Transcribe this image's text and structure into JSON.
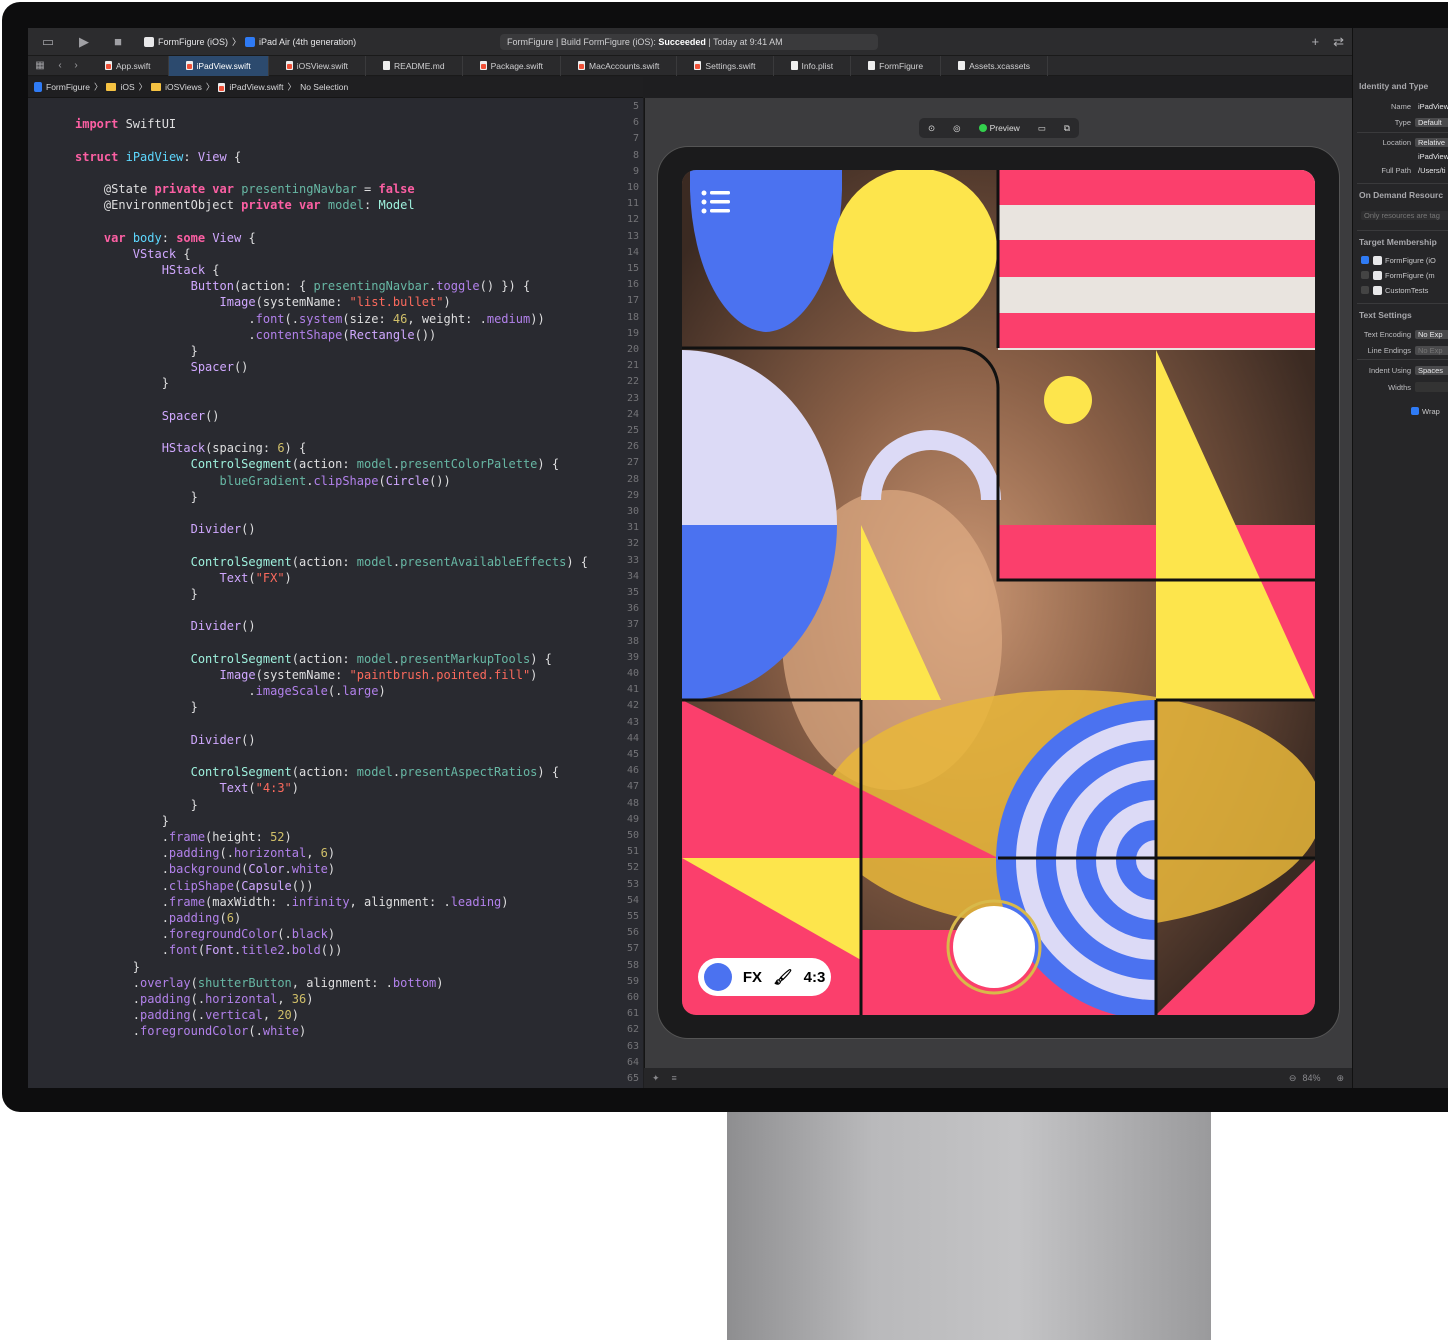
{
  "toolbar": {
    "scheme": "FormFigure (iOS)",
    "device": "iPad Air (4th generation)",
    "status_prefix": "FormFigure | Build FormFigure (iOS): ",
    "status_result": "Succeeded",
    "status_time": " | Today at 9:41 AM"
  },
  "tabs": [
    {
      "label": "App.swift"
    },
    {
      "label": "iPadView.swift",
      "active": true
    },
    {
      "label": "iOSView.swift"
    },
    {
      "label": "README.md"
    },
    {
      "label": "Package.swift"
    },
    {
      "label": "MacAccounts.swift"
    },
    {
      "label": "Settings.swift"
    },
    {
      "label": "Info.plist"
    },
    {
      "label": "FormFigure"
    },
    {
      "label": "Assets.xcassets"
    }
  ],
  "breadcrumb": [
    "FormFigure",
    "iOS",
    "iOSViews",
    "iPadView.swift",
    "No Selection"
  ],
  "code": {
    "first_line": 5,
    "lines": [
      [],
      [
        [
          "k",
          "import"
        ],
        [
          "p",
          " SwiftUI"
        ]
      ],
      [],
      [
        [
          "k",
          "struct"
        ],
        [
          "p",
          " "
        ],
        [
          "d",
          "iPadView"
        ],
        [
          "p",
          ": "
        ],
        [
          "st",
          "View"
        ],
        [
          "p",
          " {"
        ]
      ],
      [],
      [
        [
          "p",
          "    @State "
        ],
        [
          "k",
          "private var"
        ],
        [
          "p",
          " "
        ],
        [
          "m",
          "presentingNavbar"
        ],
        [
          "p",
          " = "
        ],
        [
          "k",
          "false"
        ]
      ],
      [
        [
          "p",
          "    @EnvironmentObject "
        ],
        [
          "k",
          "private var"
        ],
        [
          "p",
          " "
        ],
        [
          "m",
          "model"
        ],
        [
          "p",
          ": "
        ],
        [
          "t",
          "Model"
        ]
      ],
      [],
      [
        [
          "p",
          "    "
        ],
        [
          "k",
          "var"
        ],
        [
          "p",
          " "
        ],
        [
          "d",
          "body"
        ],
        [
          "p",
          ": "
        ],
        [
          "k",
          "some"
        ],
        [
          "p",
          " "
        ],
        [
          "st",
          "View"
        ],
        [
          "p",
          " {"
        ]
      ],
      [
        [
          "p",
          "        "
        ],
        [
          "st",
          "VStack"
        ],
        [
          "p",
          " {"
        ]
      ],
      [
        [
          "p",
          "            "
        ],
        [
          "st",
          "HStack"
        ],
        [
          "p",
          " {"
        ]
      ],
      [
        [
          "p",
          "                "
        ],
        [
          "st",
          "Button"
        ],
        [
          "p",
          "(action: { "
        ],
        [
          "m",
          "presentingNavbar"
        ],
        [
          "p",
          "."
        ],
        [
          "sm",
          "toggle"
        ],
        [
          "p",
          "() }) {"
        ]
      ],
      [
        [
          "p",
          "                    "
        ],
        [
          "st",
          "Image"
        ],
        [
          "p",
          "(systemName: "
        ],
        [
          "s",
          "\"list.bullet\""
        ],
        [
          "p",
          ")"
        ]
      ],
      [
        [
          "p",
          "                        ."
        ],
        [
          "sm",
          "font"
        ],
        [
          "p",
          "(."
        ],
        [
          "sm",
          "system"
        ],
        [
          "p",
          "(size: "
        ],
        [
          "n",
          "46"
        ],
        [
          "p",
          ", weight: ."
        ],
        [
          "sm",
          "medium"
        ],
        [
          "p",
          "))"
        ]
      ],
      [
        [
          "p",
          "                        ."
        ],
        [
          "sm",
          "contentShape"
        ],
        [
          "p",
          "("
        ],
        [
          "st",
          "Rectangle"
        ],
        [
          "p",
          "())"
        ]
      ],
      [
        [
          "p",
          "                }"
        ]
      ],
      [
        [
          "p",
          "                "
        ],
        [
          "st",
          "Spacer"
        ],
        [
          "p",
          "()"
        ]
      ],
      [
        [
          "p",
          "            }"
        ]
      ],
      [],
      [
        [
          "p",
          "            "
        ],
        [
          "st",
          "Spacer"
        ],
        [
          "p",
          "()"
        ]
      ],
      [],
      [
        [
          "p",
          "            "
        ],
        [
          "st",
          "HStack"
        ],
        [
          "p",
          "(spacing: "
        ],
        [
          "n",
          "6"
        ],
        [
          "p",
          ") {"
        ]
      ],
      [
        [
          "p",
          "                "
        ],
        [
          "t",
          "ControlSegment"
        ],
        [
          "p",
          "(action: "
        ],
        [
          "m",
          "model"
        ],
        [
          "p",
          "."
        ],
        [
          "m",
          "presentColorPalette"
        ],
        [
          "p",
          ") {"
        ]
      ],
      [
        [
          "p",
          "                    "
        ],
        [
          "m",
          "blueGradient"
        ],
        [
          "p",
          "."
        ],
        [
          "sm",
          "clipShape"
        ],
        [
          "p",
          "("
        ],
        [
          "st",
          "Circle"
        ],
        [
          "p",
          "())"
        ]
      ],
      [
        [
          "p",
          "                }"
        ]
      ],
      [],
      [
        [
          "p",
          "                "
        ],
        [
          "st",
          "Divider"
        ],
        [
          "p",
          "()"
        ]
      ],
      [],
      [
        [
          "p",
          "                "
        ],
        [
          "t",
          "ControlSegment"
        ],
        [
          "p",
          "(action: "
        ],
        [
          "m",
          "model"
        ],
        [
          "p",
          "."
        ],
        [
          "m",
          "presentAvailableEffects"
        ],
        [
          "p",
          ") {"
        ]
      ],
      [
        [
          "p",
          "                    "
        ],
        [
          "st",
          "Text"
        ],
        [
          "p",
          "("
        ],
        [
          "s",
          "\"FX\""
        ],
        [
          "p",
          ")"
        ]
      ],
      [
        [
          "p",
          "                }"
        ]
      ],
      [],
      [
        [
          "p",
          "                "
        ],
        [
          "st",
          "Divider"
        ],
        [
          "p",
          "()"
        ]
      ],
      [],
      [
        [
          "p",
          "                "
        ],
        [
          "t",
          "ControlSegment"
        ],
        [
          "p",
          "(action: "
        ],
        [
          "m",
          "model"
        ],
        [
          "p",
          "."
        ],
        [
          "m",
          "presentMarkupTools"
        ],
        [
          "p",
          ") {"
        ]
      ],
      [
        [
          "p",
          "                    "
        ],
        [
          "st",
          "Image"
        ],
        [
          "p",
          "(systemName: "
        ],
        [
          "s",
          "\"paintbrush.pointed.fill\""
        ],
        [
          "p",
          ")"
        ]
      ],
      [
        [
          "p",
          "                        ."
        ],
        [
          "sm",
          "imageScale"
        ],
        [
          "p",
          "(."
        ],
        [
          "sm",
          "large"
        ],
        [
          "p",
          ")"
        ]
      ],
      [
        [
          "p",
          "                }"
        ]
      ],
      [],
      [
        [
          "p",
          "                "
        ],
        [
          "st",
          "Divider"
        ],
        [
          "p",
          "()"
        ]
      ],
      [],
      [
        [
          "p",
          "                "
        ],
        [
          "t",
          "ControlSegment"
        ],
        [
          "p",
          "(action: "
        ],
        [
          "m",
          "model"
        ],
        [
          "p",
          "."
        ],
        [
          "m",
          "presentAspectRatios"
        ],
        [
          "p",
          ") {"
        ]
      ],
      [
        [
          "p",
          "                    "
        ],
        [
          "st",
          "Text"
        ],
        [
          "p",
          "("
        ],
        [
          "s",
          "\"4:3\""
        ],
        [
          "p",
          ")"
        ]
      ],
      [
        [
          "p",
          "                }"
        ]
      ],
      [
        [
          "p",
          "            }"
        ]
      ],
      [
        [
          "p",
          "            ."
        ],
        [
          "sm",
          "frame"
        ],
        [
          "p",
          "(height: "
        ],
        [
          "n",
          "52"
        ],
        [
          "p",
          ")"
        ]
      ],
      [
        [
          "p",
          "            ."
        ],
        [
          "sm",
          "padding"
        ],
        [
          "p",
          "(."
        ],
        [
          "sm",
          "horizontal"
        ],
        [
          "p",
          ", "
        ],
        [
          "n",
          "6"
        ],
        [
          "p",
          ")"
        ]
      ],
      [
        [
          "p",
          "            ."
        ],
        [
          "sm",
          "background"
        ],
        [
          "p",
          "("
        ],
        [
          "st",
          "Color"
        ],
        [
          "p",
          "."
        ],
        [
          "sm",
          "white"
        ],
        [
          "p",
          ")"
        ]
      ],
      [
        [
          "p",
          "            ."
        ],
        [
          "sm",
          "clipShape"
        ],
        [
          "p",
          "("
        ],
        [
          "st",
          "Capsule"
        ],
        [
          "p",
          "())"
        ]
      ],
      [
        [
          "p",
          "            ."
        ],
        [
          "sm",
          "frame"
        ],
        [
          "p",
          "(maxWidth: ."
        ],
        [
          "sm",
          "infinity"
        ],
        [
          "p",
          ", alignment: ."
        ],
        [
          "sm",
          "leading"
        ],
        [
          "p",
          ")"
        ]
      ],
      [
        [
          "p",
          "            ."
        ],
        [
          "sm",
          "padding"
        ],
        [
          "p",
          "("
        ],
        [
          "n",
          "6"
        ],
        [
          "p",
          ")"
        ]
      ],
      [
        [
          "p",
          "            ."
        ],
        [
          "sm",
          "foregroundColor"
        ],
        [
          "p",
          "(."
        ],
        [
          "sm",
          "black"
        ],
        [
          "p",
          ")"
        ]
      ],
      [
        [
          "p",
          "            ."
        ],
        [
          "sm",
          "font"
        ],
        [
          "p",
          "("
        ],
        [
          "st",
          "Font"
        ],
        [
          "p",
          "."
        ],
        [
          "sm",
          "title2"
        ],
        [
          "p",
          "."
        ],
        [
          "sm",
          "bold"
        ],
        [
          "p",
          "())"
        ]
      ],
      [
        [
          "p",
          "        }"
        ]
      ],
      [
        [
          "p",
          "        ."
        ],
        [
          "sm",
          "overlay"
        ],
        [
          "p",
          "("
        ],
        [
          "m",
          "shutterButton"
        ],
        [
          "p",
          ", alignment: ."
        ],
        [
          "sm",
          "bottom"
        ],
        [
          "p",
          ")"
        ]
      ],
      [
        [
          "p",
          "        ."
        ],
        [
          "sm",
          "padding"
        ],
        [
          "p",
          "(."
        ],
        [
          "sm",
          "horizontal"
        ],
        [
          "p",
          ", "
        ],
        [
          "n",
          "36"
        ],
        [
          "p",
          ")"
        ]
      ],
      [
        [
          "p",
          "        ."
        ],
        [
          "sm",
          "padding"
        ],
        [
          "p",
          "(."
        ],
        [
          "sm",
          "vertical"
        ],
        [
          "p",
          ", "
        ],
        [
          "n",
          "20"
        ],
        [
          "p",
          ")"
        ]
      ],
      [
        [
          "p",
          "        ."
        ],
        [
          "sm",
          "foregroundColor"
        ],
        [
          "p",
          "(."
        ],
        [
          "sm",
          "white"
        ],
        [
          "p",
          ")"
        ]
      ],
      [],
      [],
      []
    ]
  },
  "preview": {
    "label": "Preview",
    "status_color": "#33d14d",
    "controls": {
      "fx": "FX",
      "ratio": "4:3"
    },
    "zoom": "84%"
  },
  "colors": {
    "blue": "#4b72f0",
    "yellow": "#fde54c",
    "pink": "#fb3f6c",
    "lavender": "#dcdaf6"
  },
  "inspector": {
    "identity": {
      "title": "Identity and Type",
      "name_label": "Name",
      "name": "iPadView",
      "type_label": "Type",
      "type": "Default",
      "location_label": "Location",
      "location": "Relative",
      "location_file": "iPadView",
      "fullpath_label": "Full Path",
      "fullpath": "/Users/ti"
    },
    "ondemand": {
      "title": "On Demand Resourc",
      "placeholder": "Only resources are tag"
    },
    "target": {
      "title": "Target Membership",
      "items": [
        {
          "label": "FormFigure (iO",
          "checked": true
        },
        {
          "label": "FormFigure (m",
          "checked": false
        },
        {
          "label": "CustomTests",
          "checked": false
        }
      ]
    },
    "text": {
      "title": "Text Settings",
      "encoding_label": "Text Encoding",
      "encoding": "No Exp",
      "endings_label": "Line Endings",
      "endings": "No Exp",
      "indent_label": "Indent Using",
      "indent": "Spaces",
      "widths_label": "Widths",
      "wrap": "Wrap"
    }
  }
}
